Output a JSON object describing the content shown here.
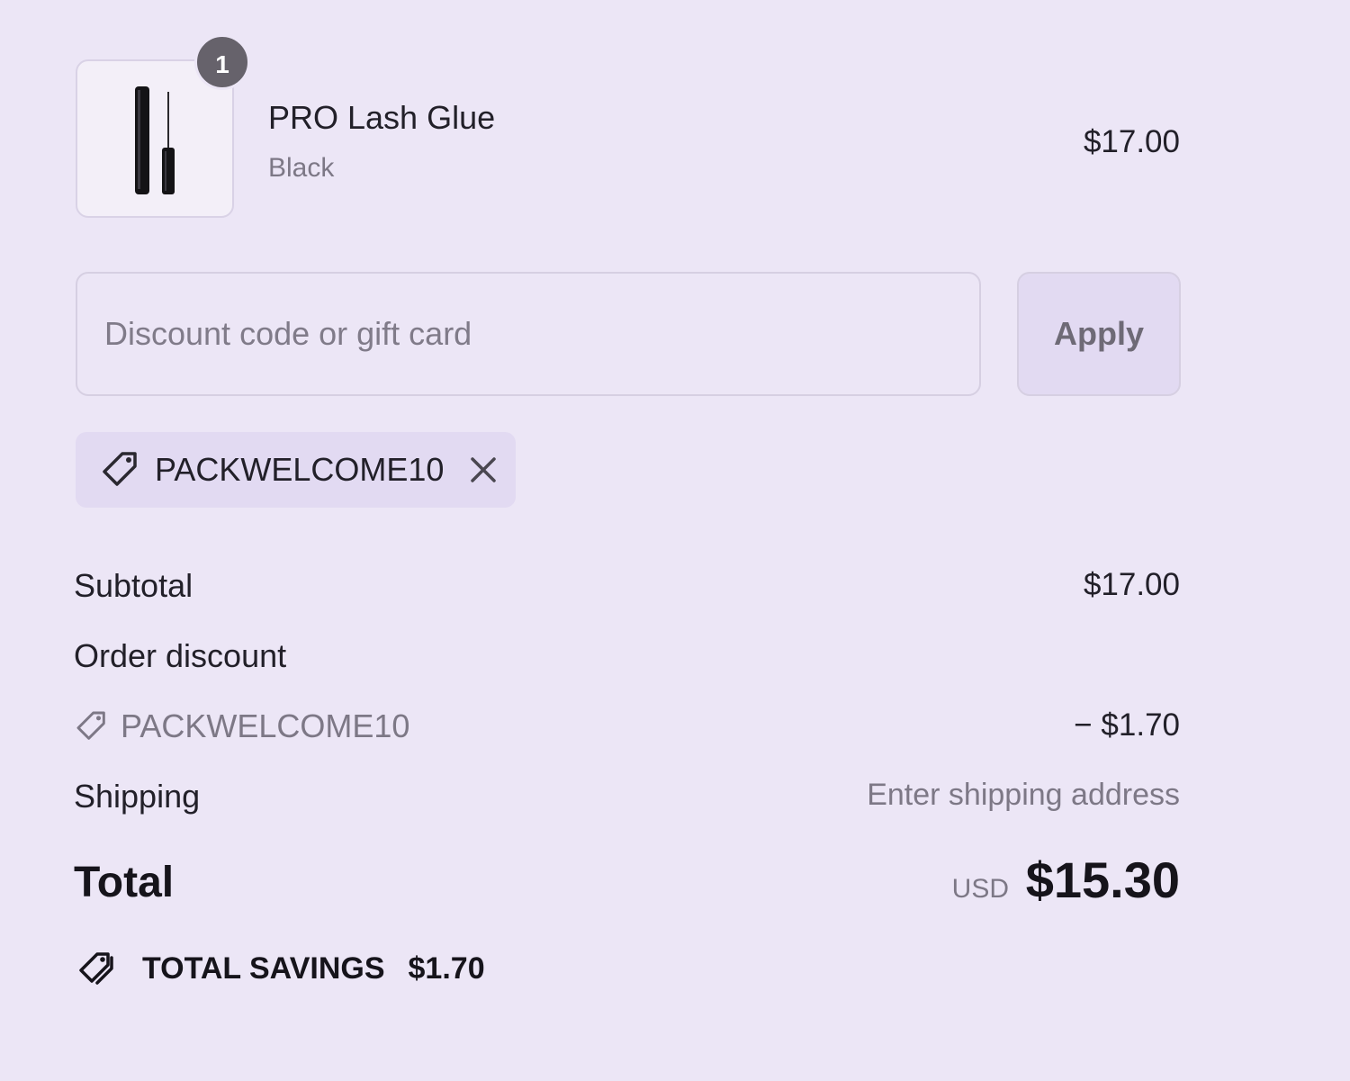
{
  "product": {
    "quantity": "1",
    "name": "PRO Lash Glue",
    "variant": "Black",
    "price": "$17.00",
    "image_icon": "lash-glue-bottle-icon"
  },
  "discount": {
    "placeholder": "Discount code or gift card",
    "apply_label": "Apply",
    "applied_code": "PACKWELCOME10"
  },
  "summary": {
    "subtotal_label": "Subtotal",
    "subtotal_value": "$17.00",
    "order_discount_label": "Order discount",
    "code_label": "PACKWELCOME10",
    "code_value": "− $1.70",
    "shipping_label": "Shipping",
    "shipping_value": "Enter shipping address",
    "total_label": "Total",
    "currency": "USD",
    "total_value": "$15.30",
    "savings_label": "TOTAL SAVINGS",
    "savings_value": "$1.70"
  },
  "colors": {
    "background": "#ece6f6",
    "chip": "#e2daf2",
    "badge": "#66626b",
    "muted_text": "#7d7886"
  }
}
